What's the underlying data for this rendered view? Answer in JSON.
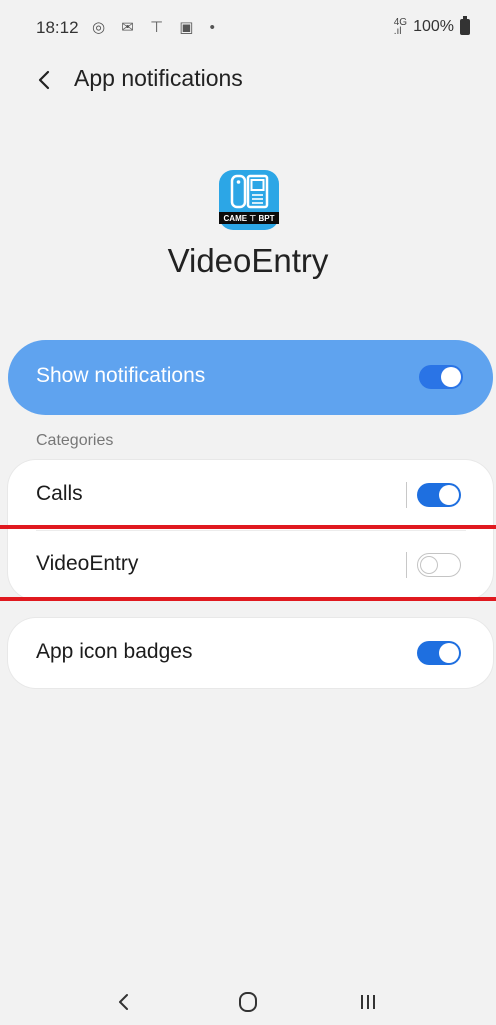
{
  "status_bar": {
    "time": "18:12",
    "notification_icons": "◎ ✉ ⊤ ▣ •",
    "network": "4G",
    "battery": "100%"
  },
  "header": {
    "title": "App notifications"
  },
  "app": {
    "name": "VideoEntry",
    "icon_caption": "CAME ⊤ BPT",
    "icon_color": "#2ca6e6"
  },
  "show_notifications": {
    "label": "Show notifications",
    "enabled": true
  },
  "categories_label": "Categories",
  "categories": [
    {
      "label": "Calls",
      "enabled": true
    },
    {
      "label": "VideoEntry",
      "enabled": false
    }
  ],
  "app_icon_badges": {
    "label": "App icon badges",
    "enabled": true
  },
  "colors": {
    "accent": "#1e6fe0",
    "main_switch_bg": "#5fa3ef",
    "highlight": "#e0191f",
    "background": "#f2f2f2"
  },
  "navigation": {
    "back": "back-icon",
    "home": "home-icon",
    "recents": "recents-icon"
  }
}
